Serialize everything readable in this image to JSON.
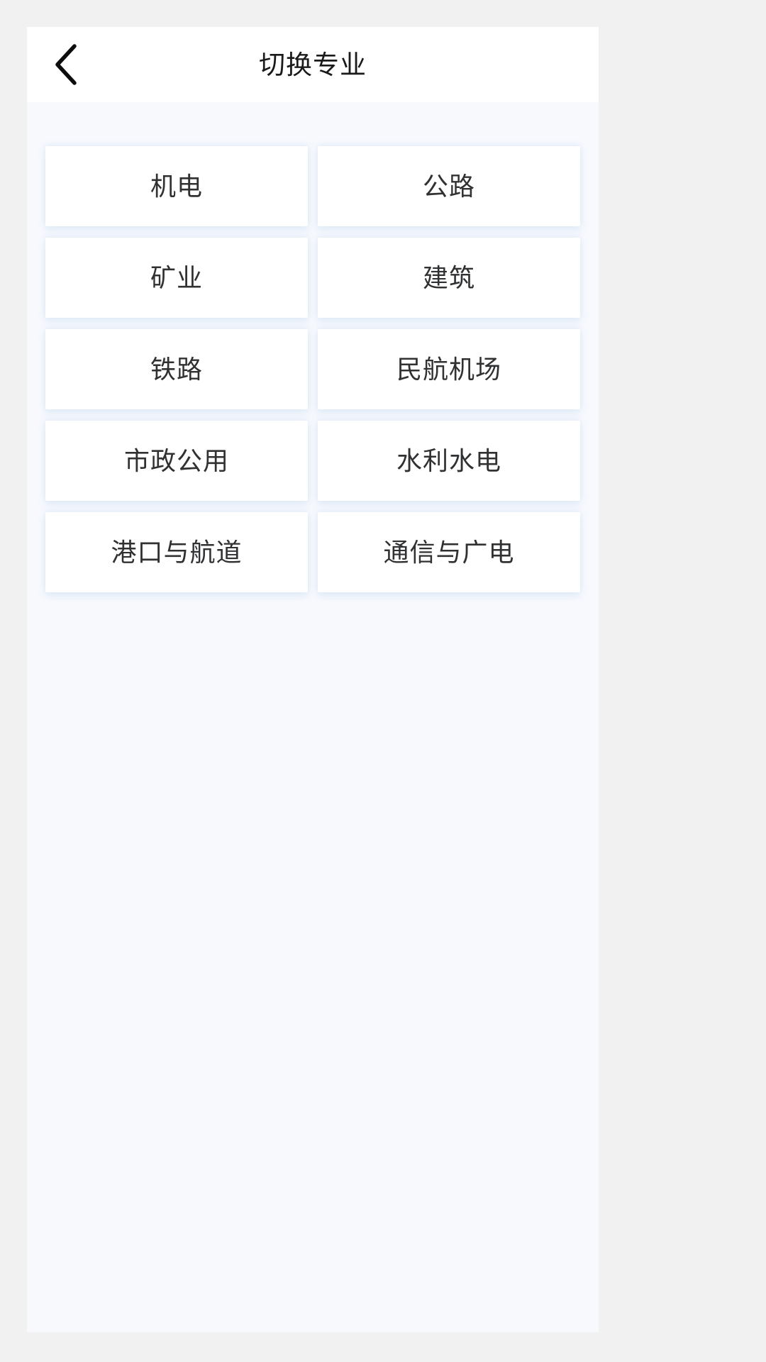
{
  "page": {
    "background_color": "#f1f1f1",
    "viewport_background": "#f7f9fd"
  },
  "header": {
    "title": "切换专业",
    "background_color": "#ffffff",
    "back_icon": "chevron-left-icon",
    "title_color": "#1a1a1a"
  },
  "grid": {
    "columns": 2,
    "card_background": "#ffffff",
    "label_color": "#303133",
    "shadow_color": "#bed4f0",
    "items": [
      {
        "label": "机电"
      },
      {
        "label": "公路"
      },
      {
        "label": "矿业"
      },
      {
        "label": "建筑"
      },
      {
        "label": "铁路"
      },
      {
        "label": "民航机场"
      },
      {
        "label": "市政公用"
      },
      {
        "label": "水利水电"
      },
      {
        "label": "港口与航道"
      },
      {
        "label": "通信与广电"
      }
    ]
  }
}
